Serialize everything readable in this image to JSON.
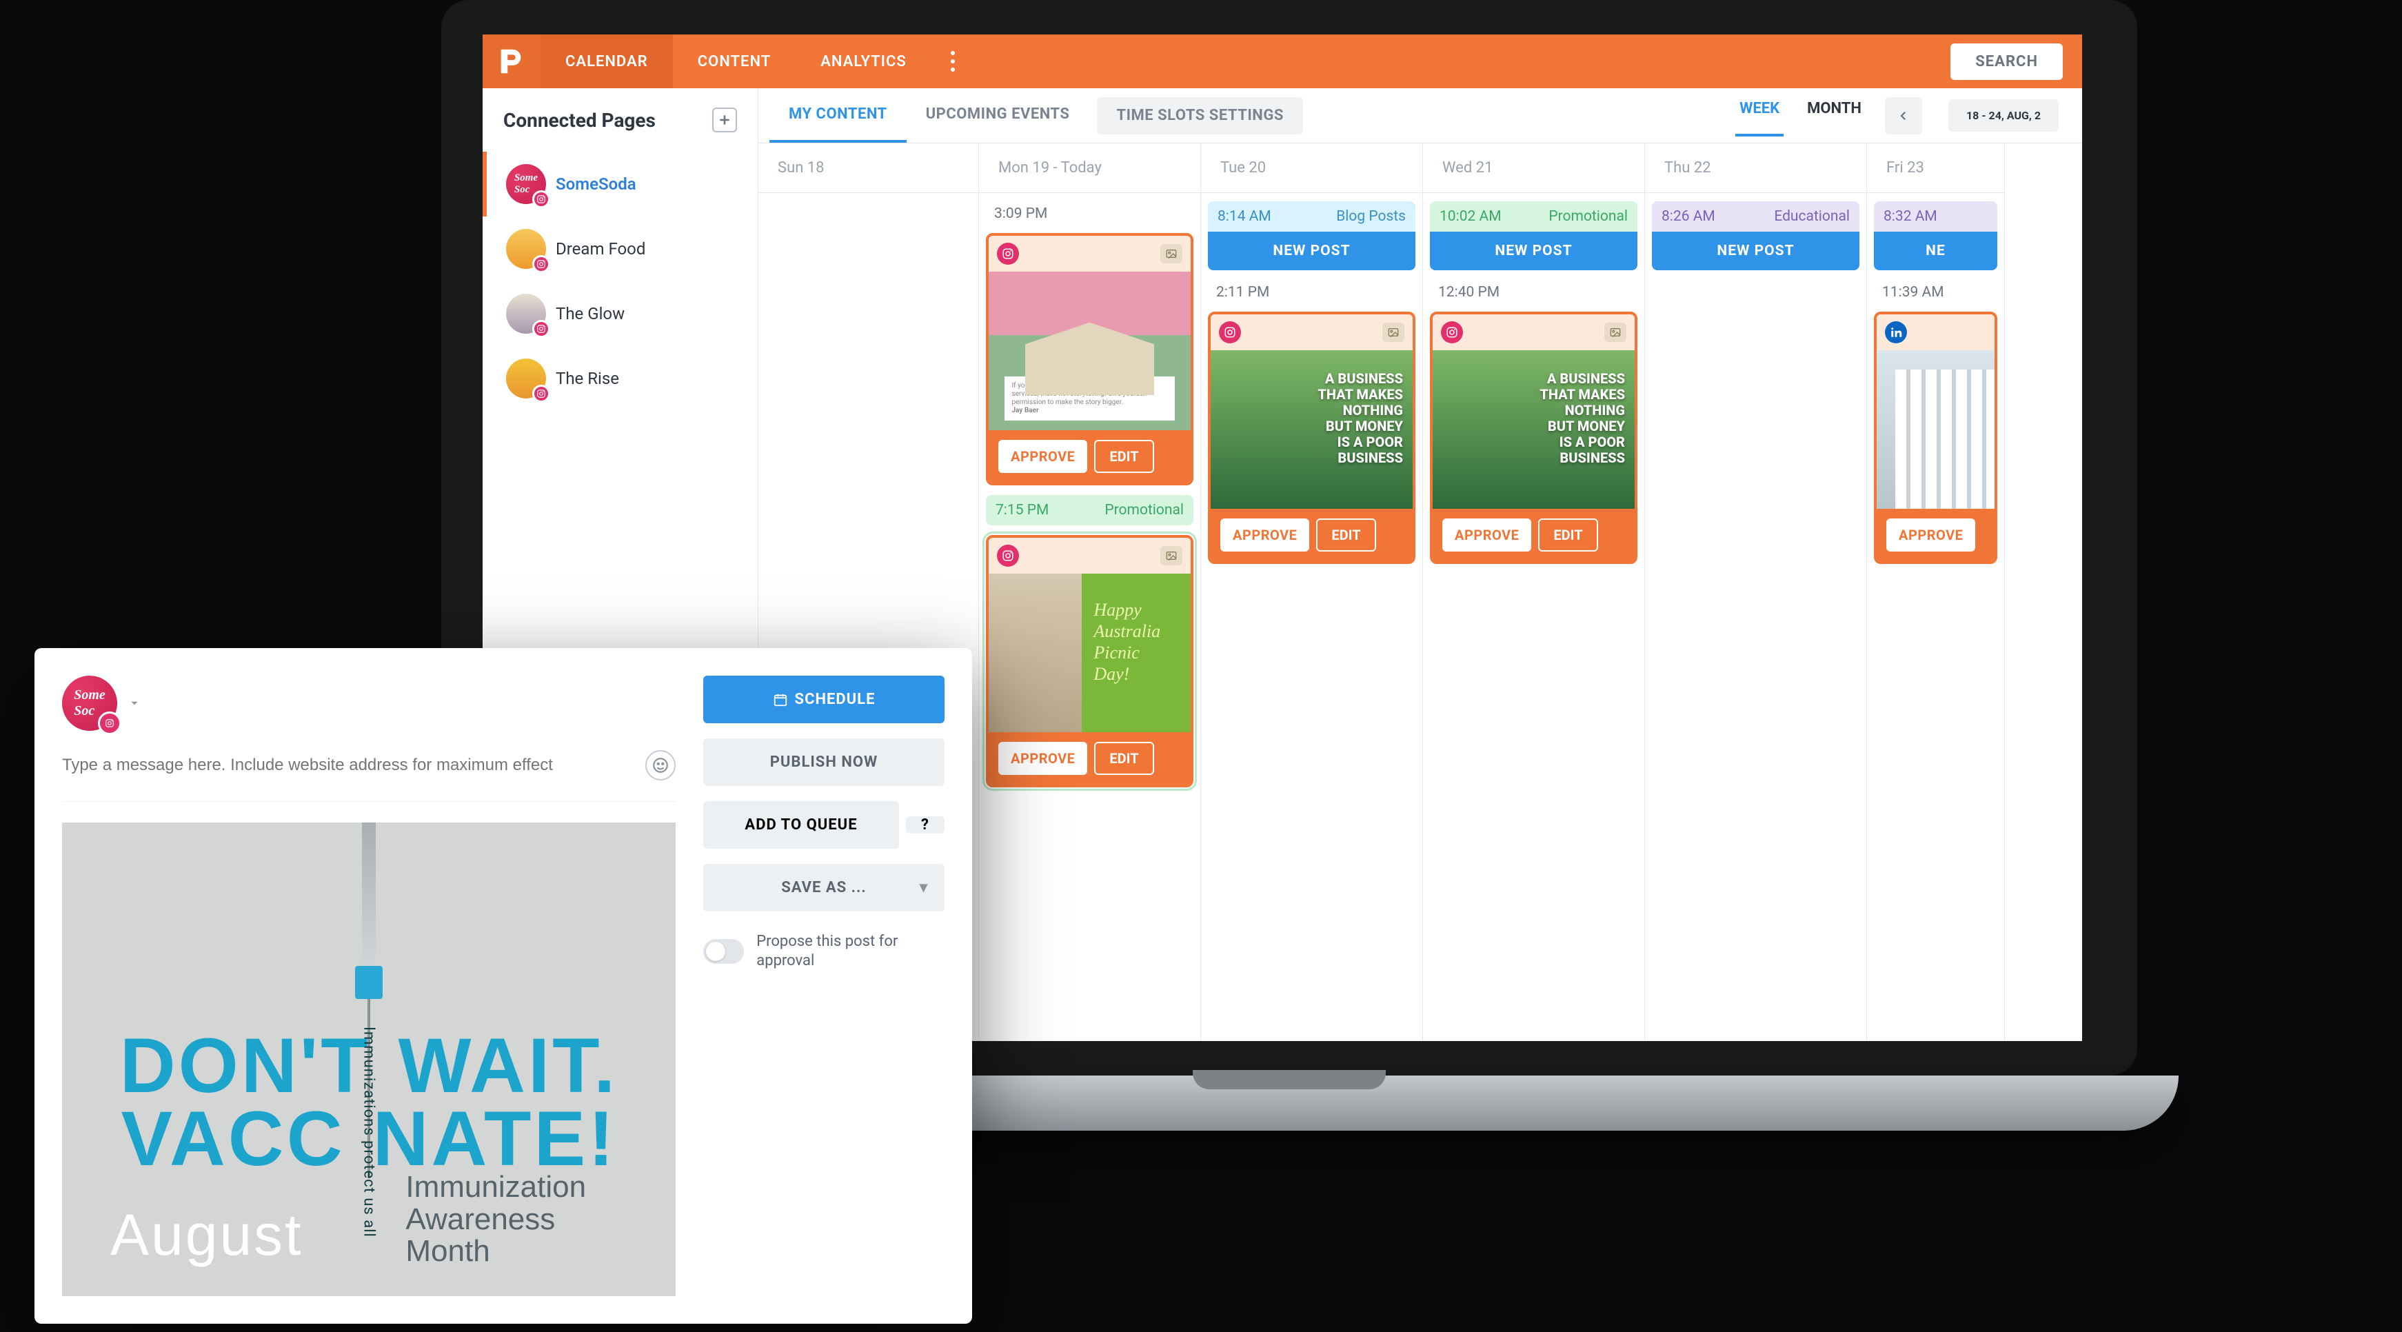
{
  "nav": {
    "calendar": "CALENDAR",
    "content": "CONTENT",
    "analytics": "ANALYTICS",
    "search": "SEARCH"
  },
  "sidebar": {
    "title": "Connected Pages",
    "pages": [
      {
        "name": "SomeSoda"
      },
      {
        "name": "Dream Food"
      },
      {
        "name": "The Glow"
      },
      {
        "name": "The Rise"
      }
    ]
  },
  "tabs": {
    "my_content": "MY CONTENT",
    "upcoming": "UPCOMING EVENTS",
    "slot_settings": "TIME SLOTS SETTINGS",
    "week": "WEEK",
    "month": "MONTH",
    "date_range": "18 - 24, AUG, 2"
  },
  "days": {
    "sun": "Sun 18",
    "mon": "Mon 19 - Today",
    "tue": "Tue 20",
    "wed": "Wed 21",
    "thu": "Thu 22",
    "fri": "Fri 23"
  },
  "category": {
    "blog": "Blog Posts",
    "promo": "Promotional",
    "edu": "Educational"
  },
  "labels": {
    "new_post": "NEW POST",
    "approve": "APPROVE",
    "edit": "EDIT"
  },
  "slots": {
    "tue_time": "8:14 AM",
    "wed_time": "10:02 AM",
    "thu_time": "8:26 AM",
    "fri_time": "8:32 AM"
  },
  "posts": {
    "mon1_time": "3:09 PM",
    "mon2_time": "7:15 PM",
    "tue_time": "2:11 PM",
    "wed_time": "12:40 PM",
    "fri_time": "11:39 AM",
    "forest_line1": "A BUSINESS",
    "forest_line2": "THAT MAKES",
    "forest_line3": "NOTHING",
    "forest_line4": "BUT MONEY",
    "forest_line5": "IS A POOR",
    "forest_line6": "BUSINESS",
    "picnic_line1": "Happy",
    "picnic_line2": "Australia",
    "picnic_line3": "Picnic",
    "picnic_line4": "Day!",
    "house_caption": "If your stories are all about your products and services, that's not storytelling. Give yourself permission to make the story bigger.",
    "house_author": "Jay Baer",
    "fri_new": "NE"
  },
  "compose": {
    "placeholder": "Type a message here. Include website address for maximum effect",
    "schedule": "SCHEDULE",
    "publish_now": "PUBLISH NOW",
    "add_queue": "ADD TO QUEUE",
    "save_as": "SAVE AS ...",
    "propose": "Propose this post for approval",
    "q_mark": "?",
    "vax_line1a": "DON'T",
    "vax_line1b": "WAIT.",
    "vax_line2a": "VACC",
    "vax_line2b": "NATE!",
    "vax_vert": "Immunizations protect us all",
    "vax_month": "August",
    "vax_sub1": "Immunization",
    "vax_sub2": "Awareness",
    "vax_sub3": "Month"
  }
}
